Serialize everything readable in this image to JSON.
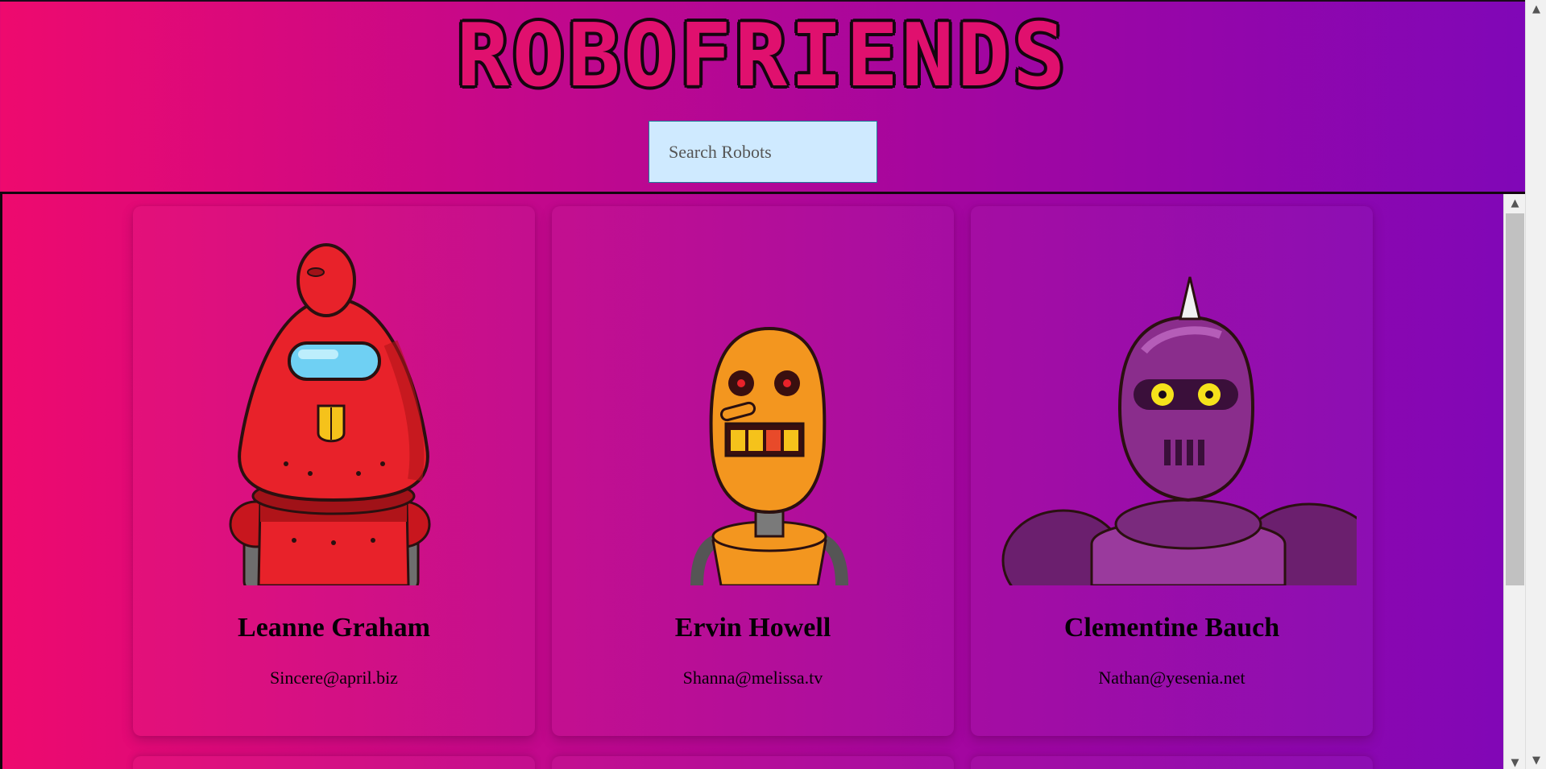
{
  "app": {
    "logo_text": "ROBOFRIENDS"
  },
  "search": {
    "placeholder": "Search Robots",
    "value": ""
  },
  "robots": [
    {
      "name": "Leanne Graham",
      "email": "Sincere@april.biz",
      "color": "#e8222a"
    },
    {
      "name": "Ervin Howell",
      "email": "Shanna@melissa.tv",
      "color": "#f3961f"
    },
    {
      "name": "Clementine Bauch",
      "email": "Nathan@yesenia.net",
      "color": "#8a2d8c"
    }
  ],
  "colors": {
    "gradient_start": "#ee0a6e",
    "gradient_end": "#7f07b8",
    "search_bg": "#cfeaff"
  }
}
